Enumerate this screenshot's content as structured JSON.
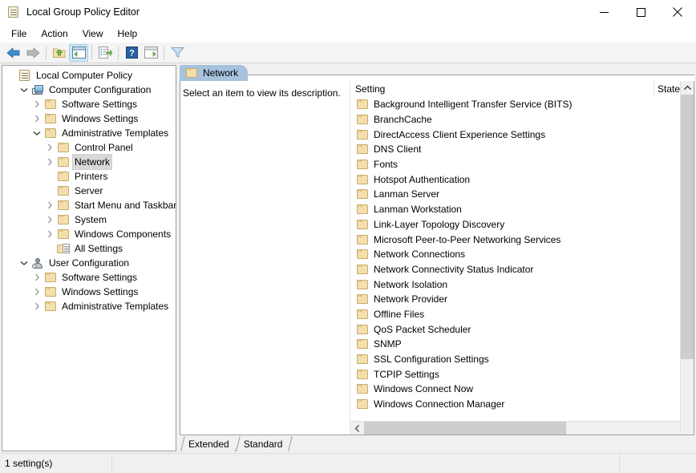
{
  "window": {
    "title": "Local Group Policy Editor",
    "icon": "policy-scroll-icon",
    "minimize": "–",
    "maximize": "□",
    "close": "✕"
  },
  "menu": {
    "items": [
      {
        "label": "File"
      },
      {
        "label": "Action"
      },
      {
        "label": "View"
      },
      {
        "label": "Help"
      }
    ]
  },
  "toolbar": {
    "buttons": [
      {
        "name": "back-icon",
        "title": "Back"
      },
      {
        "name": "forward-icon",
        "title": "Forward"
      },
      {
        "name": "up-one-level-icon",
        "title": "Up One Level"
      },
      {
        "name": "show-hide-console-tree-icon",
        "title": "Show/Hide Console Tree"
      },
      {
        "name": "export-list-icon",
        "title": "Export List"
      },
      {
        "name": "help-icon",
        "title": "Help"
      },
      {
        "name": "show-hide-action-pane-icon",
        "title": "Show/Hide Action Pane"
      },
      {
        "name": "filter-icon",
        "title": "Filter"
      }
    ]
  },
  "tree": {
    "nodes": [
      {
        "label": "Local Computer Policy",
        "indent": 0,
        "twisty": "none",
        "icon": "policy-scroll-icon",
        "selected": false
      },
      {
        "label": "Computer Configuration",
        "indent": 1,
        "twisty": "expanded",
        "icon": "computer-icon",
        "selected": false
      },
      {
        "label": "Software Settings",
        "indent": 2,
        "twisty": "collapsed",
        "icon": "folder-icon",
        "selected": false
      },
      {
        "label": "Windows Settings",
        "indent": 2,
        "twisty": "collapsed",
        "icon": "folder-icon",
        "selected": false
      },
      {
        "label": "Administrative Templates",
        "indent": 2,
        "twisty": "expanded",
        "icon": "folder-icon",
        "selected": false
      },
      {
        "label": "Control Panel",
        "indent": 3,
        "twisty": "collapsed",
        "icon": "folder-icon",
        "selected": false
      },
      {
        "label": "Network",
        "indent": 3,
        "twisty": "collapsed",
        "icon": "folder-icon",
        "selected": true
      },
      {
        "label": "Printers",
        "indent": 3,
        "twisty": "none",
        "icon": "folder-icon",
        "selected": false
      },
      {
        "label": "Server",
        "indent": 3,
        "twisty": "none",
        "icon": "folder-icon",
        "selected": false
      },
      {
        "label": "Start Menu and Taskbar",
        "indent": 3,
        "twisty": "collapsed",
        "icon": "folder-icon",
        "selected": false
      },
      {
        "label": "System",
        "indent": 3,
        "twisty": "collapsed",
        "icon": "folder-icon",
        "selected": false
      },
      {
        "label": "Windows Components",
        "indent": 3,
        "twisty": "collapsed",
        "icon": "folder-icon",
        "selected": false
      },
      {
        "label": "All Settings",
        "indent": 3,
        "twisty": "none",
        "icon": "all-settings-icon",
        "selected": false
      },
      {
        "label": "User Configuration",
        "indent": 1,
        "twisty": "expanded",
        "icon": "user-icon",
        "selected": false
      },
      {
        "label": "Software Settings",
        "indent": 2,
        "twisty": "collapsed",
        "icon": "folder-icon",
        "selected": false
      },
      {
        "label": "Windows Settings",
        "indent": 2,
        "twisty": "collapsed",
        "icon": "folder-icon",
        "selected": false
      },
      {
        "label": "Administrative Templates",
        "indent": 2,
        "twisty": "collapsed",
        "icon": "folder-icon",
        "selected": false
      }
    ]
  },
  "pane": {
    "tab_label": "Network",
    "tab_icon": "folder-icon",
    "description": "Select an item to view its description.",
    "columns": [
      {
        "label": "Setting"
      },
      {
        "label": "State"
      }
    ],
    "sort_indicator": "caret-up-icon",
    "rows": [
      {
        "setting": "Background Intelligent Transfer Service (BITS)",
        "state": ""
      },
      {
        "setting": "BranchCache",
        "state": ""
      },
      {
        "setting": "DirectAccess Client Experience Settings",
        "state": ""
      },
      {
        "setting": "DNS Client",
        "state": ""
      },
      {
        "setting": "Fonts",
        "state": ""
      },
      {
        "setting": "Hotspot Authentication",
        "state": ""
      },
      {
        "setting": "Lanman Server",
        "state": ""
      },
      {
        "setting": "Lanman Workstation",
        "state": ""
      },
      {
        "setting": "Link-Layer Topology Discovery",
        "state": ""
      },
      {
        "setting": "Microsoft Peer-to-Peer Networking Services",
        "state": ""
      },
      {
        "setting": "Network Connections",
        "state": ""
      },
      {
        "setting": "Network Connectivity Status Indicator",
        "state": ""
      },
      {
        "setting": "Network Isolation",
        "state": ""
      },
      {
        "setting": "Network Provider",
        "state": ""
      },
      {
        "setting": "Offline Files",
        "state": ""
      },
      {
        "setting": "QoS Packet Scheduler",
        "state": ""
      },
      {
        "setting": "SNMP",
        "state": ""
      },
      {
        "setting": "SSL Configuration Settings",
        "state": ""
      },
      {
        "setting": "TCPIP Settings",
        "state": ""
      },
      {
        "setting": "Windows Connect Now",
        "state": ""
      },
      {
        "setting": "Windows Connection Manager",
        "state": ""
      }
    ],
    "hscroll_left": "‹",
    "hscroll_right": "›"
  },
  "bottom_tabs": [
    {
      "label": "Extended",
      "active": false
    },
    {
      "label": "Standard",
      "active": true
    }
  ],
  "statusbar": {
    "text": "1 setting(s)",
    "segment2": "",
    "segment3": ""
  },
  "colors": {
    "tab_blue": "#a7c2dd",
    "folder_fill": "#f3dfae",
    "folder_border": "#c8ab6a",
    "selection_gray": "#d8d8d8",
    "chrome_gray": "#f0f0f0",
    "scroll_thumb": "#cdcdcd"
  }
}
